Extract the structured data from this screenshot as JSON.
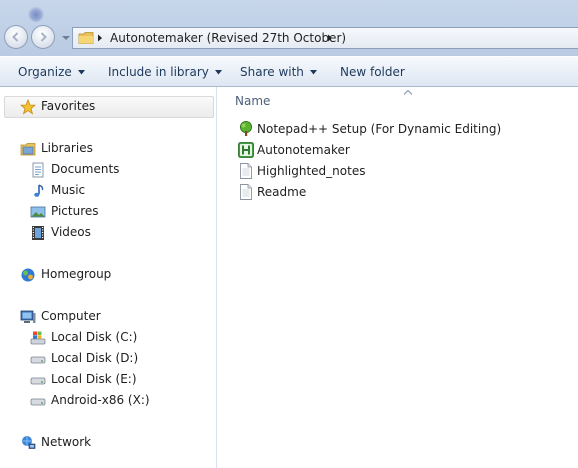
{
  "address_bar": {
    "path_segment": "Autonotemaker (Revised 27th October)"
  },
  "toolbar": {
    "organize_label": "Organize",
    "include_label": "Include in library",
    "share_label": "Share with",
    "new_folder_label": "New folder"
  },
  "nav_pane": {
    "favorites": "Favorites",
    "libraries": "Libraries",
    "documents": "Documents",
    "music": "Music",
    "pictures": "Pictures",
    "videos": "Videos",
    "homegroup": "Homegroup",
    "computer": "Computer",
    "disk_c": "Local Disk (C:)",
    "disk_d": "Local Disk (D:)",
    "disk_e": "Local Disk (E:)",
    "disk_x": "Android-x86 (X:)",
    "network": "Network"
  },
  "file_list": {
    "column_name": "Name",
    "files": [
      {
        "name": "Notepad++ Setup (For Dynamic Editing)",
        "icon": "notepad-tree-icon"
      },
      {
        "name": "Autonotemaker",
        "icon": "app-h-icon"
      },
      {
        "name": "Highlighted_notes",
        "icon": "text-document-icon"
      },
      {
        "name": "Readme",
        "icon": "text-document-icon"
      }
    ]
  },
  "colors": {
    "titlebar": "#c1d1e7",
    "command_text": "#1e395b",
    "header_text": "#4c607a"
  }
}
